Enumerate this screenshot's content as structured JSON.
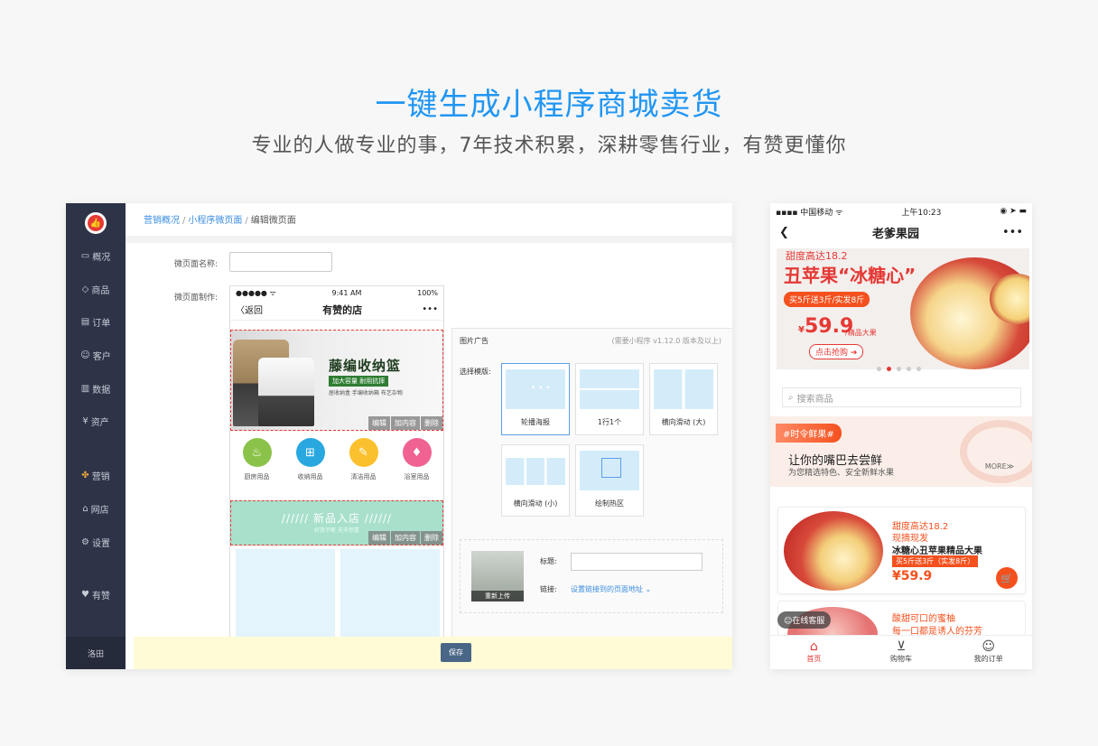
{
  "hero": {
    "title": "一键生成小程序商城卖货",
    "subtitle": "专业的人做专业的事，7年技术积累，深耕零售行业，有赞更懂你"
  },
  "admin": {
    "logo_icon": "thumbs-up-icon",
    "nav": [
      {
        "icon": "monitor-icon",
        "glyph": "▭",
        "label": "概况"
      },
      {
        "icon": "tag-icon",
        "glyph": "◇",
        "label": "商品"
      },
      {
        "icon": "list-icon",
        "glyph": "▤",
        "label": "订单"
      },
      {
        "icon": "user-icon",
        "glyph": "☺",
        "label": "客户"
      },
      {
        "icon": "chart-icon",
        "glyph": "▥",
        "label": "数据"
      },
      {
        "icon": "yen-icon",
        "glyph": "¥",
        "label": "资产"
      },
      {
        "icon": "grid-icon",
        "glyph": "✤",
        "label": "营销"
      },
      {
        "icon": "store-icon",
        "glyph": "⌂",
        "label": "网店"
      },
      {
        "icon": "gear-icon",
        "glyph": "⚙",
        "label": "设置"
      },
      {
        "icon": "thumbs-up-icon",
        "glyph": "♥",
        "label": "有赞"
      }
    ],
    "user": "洛田",
    "breadcrumb": {
      "crumb1": "营销概况",
      "crumb2": "小程序微页面",
      "current": "编辑微页面",
      "sep": "/"
    },
    "form": {
      "name_label": "微页面名称:",
      "make_label": "微页面制作:"
    },
    "phone": {
      "signal": "●●●●● ᯤ",
      "time": "9:41 AM",
      "battery": "100%",
      "back": "〈返回",
      "title": "有赞的店",
      "more": "•••",
      "banner_title": "藤编收纳篮",
      "banner_tag": "加大容量 耐用抗摔",
      "banner_small": "居收纳盒 手编收纳箱 布艺杂物",
      "edit": [
        "编辑",
        "加内容",
        "删除"
      ],
      "categories": [
        {
          "label": "厨房用品",
          "color": "#8bc34a",
          "glyph": "♨"
        },
        {
          "label": "收纳用品",
          "color": "#29a8e0",
          "glyph": "⊞"
        },
        {
          "label": "清洁用品",
          "color": "#fbc02d",
          "glyph": "✎"
        },
        {
          "label": "浴室用品",
          "color": "#f06292",
          "glyph": "♦"
        }
      ],
      "new_in_title": "//////   新品入店   //////",
      "new_in_sub": "好货不断 天天惊喜"
    },
    "config": {
      "title": "图片广告",
      "hint": "(需要小程序 v1.12.0 版本及以上)",
      "choose_label": "选择模版:",
      "templates": [
        "轮播海报",
        "1行1个",
        "横向滑动 (大)",
        "横向滑动 (小)",
        "绘制热区"
      ],
      "reupload": "重新上传",
      "title_label": "标题:",
      "link_label": "链接:",
      "link_text": "设置链接到的页面地址 ⌄"
    },
    "save": "保存"
  },
  "mobile": {
    "carrier": "▪▪▪▪ 中国移动 ᯤ",
    "time": "上午10:23",
    "status_right": "◉ ➤ ▬",
    "back_icon": "chevron-left-icon",
    "title": "老爹果园",
    "more": "•••",
    "banner": {
      "line1": "甜度高达18.2",
      "line2": "丑苹果“冰糖心”",
      "promo": "买5斤送3斤/实发8斤",
      "yen": "¥",
      "price": "59.9",
      "price_tag": "/精品大果",
      "buy": "点击抢购 ➔"
    },
    "search_placeholder": "搜索商品",
    "fresh": {
      "tag": "#时令鲜果#",
      "title": "让你的嘴巴去尝鲜",
      "sub": "为您精选特色、安全新鲜水果",
      "more": "MORE≫"
    },
    "card1": {
      "l1": "甜度高达18.2",
      "l2": "现摘现发",
      "l3": "冰糖心丑苹果精品大果",
      "tag": "买5斤送3斤（实发8斤）",
      "price": "¥59.9",
      "cart": "cart-icon"
    },
    "card2": {
      "l1": "酸甜可口的蜜柚",
      "l2": "每一口都是诱人的芬芳"
    },
    "kefu": "☺在线客服",
    "tabs": [
      {
        "icon": "home-icon",
        "glyph": "⌂",
        "label": "首页"
      },
      {
        "icon": "cart-icon",
        "glyph": "⊻",
        "label": "购物车"
      },
      {
        "icon": "user-icon",
        "glyph": "☺",
        "label": "我的订单"
      }
    ]
  }
}
